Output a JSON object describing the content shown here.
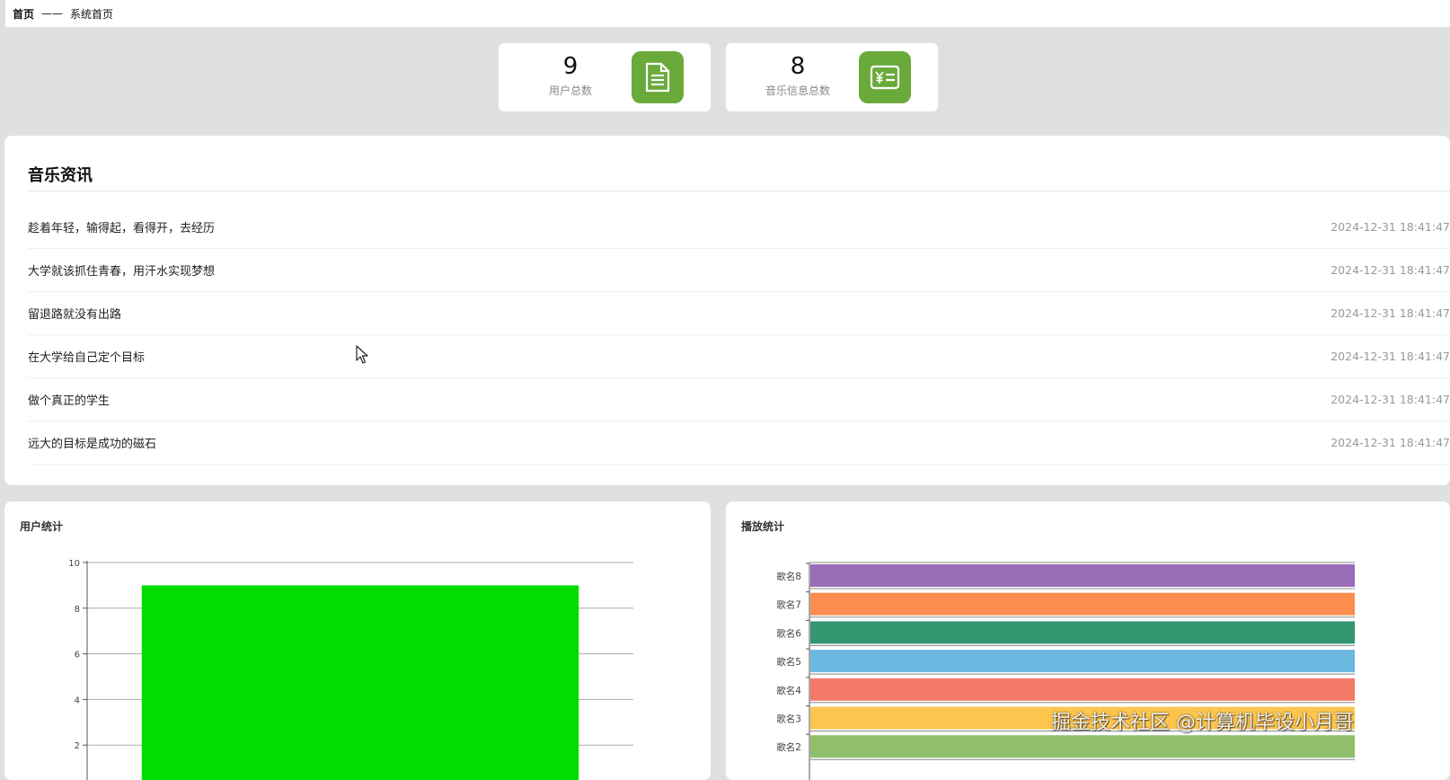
{
  "breadcrumb": {
    "home": "首页",
    "separator": "——",
    "current": "系统首页"
  },
  "stats": [
    {
      "value": "9",
      "label": "用户总数",
      "icon": "document-icon",
      "color": "#6aaa3a"
    },
    {
      "value": "8",
      "label": "音乐信息总数",
      "icon": "yen-receipt-icon",
      "color": "#6aaa3a"
    }
  ],
  "news": {
    "title": "音乐资讯",
    "items": [
      {
        "text": "趁着年轻，输得起，看得开，去经历",
        "time": "2024-12-31 18:41:47"
      },
      {
        "text": "大学就该抓住青春，用汗水实现梦想",
        "time": "2024-12-31 18:41:47"
      },
      {
        "text": "留退路就没有出路",
        "time": "2024-12-31 18:41:47"
      },
      {
        "text": "在大学给自己定个目标",
        "time": "2024-12-31 18:41:47"
      },
      {
        "text": "做个真正的学生",
        "time": "2024-12-31 18:41:47"
      },
      {
        "text": "远大的目标是成功的磁石",
        "time": "2024-12-31 18:41:47"
      }
    ]
  },
  "watermark": "掘金技术社区 @计算机毕设小月哥",
  "chart_data": [
    {
      "type": "bar",
      "title": "用户统计",
      "categories": [
        ""
      ],
      "values": [
        9
      ],
      "ylim": [
        0,
        10
      ],
      "yticks": [
        2,
        4,
        6,
        8,
        10
      ],
      "color": "#00dd00",
      "grid": true
    },
    {
      "type": "bar",
      "orientation": "horizontal",
      "title": "播放统计",
      "categories": [
        "歌名8",
        "歌名7",
        "歌名6",
        "歌名5",
        "歌名4",
        "歌名3",
        "歌名2"
      ],
      "colors": [
        "#9a6bb6",
        "#fb8d4e",
        "#339670",
        "#6bb8e0",
        "#f57967",
        "#fdc54d",
        "#8fbf6a"
      ]
    }
  ]
}
